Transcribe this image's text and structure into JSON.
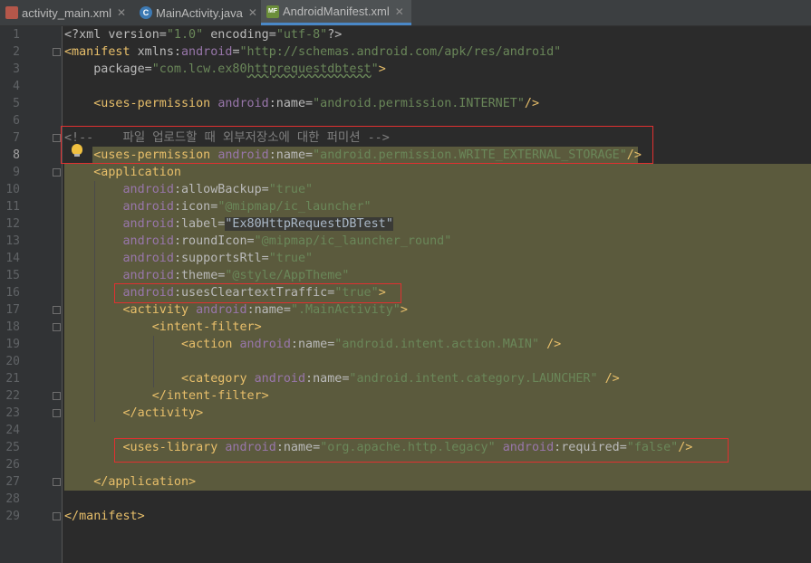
{
  "tabs": [
    {
      "label": "activity_main.xml",
      "icon": "xml-file-icon"
    },
    {
      "label": "MainActivity.java",
      "icon": "java-class-icon"
    },
    {
      "label": "AndroidManifest.xml",
      "icon": "manifest-file-icon"
    }
  ],
  "colors": {
    "tag": "#e8bf6a",
    "attr_ns": "#9876aa",
    "value": "#6a8759",
    "comment": "#808080",
    "selection": "#5b5a3d",
    "highlight_box": "#e03030"
  },
  "line_numbers": [
    "1",
    "2",
    "3",
    "4",
    "5",
    "6",
    "7",
    "8",
    "9",
    "10",
    "11",
    "12",
    "13",
    "14",
    "15",
    "16",
    "17",
    "18",
    "19",
    "20",
    "21",
    "22",
    "23",
    "24",
    "25",
    "26",
    "27",
    "28",
    "29"
  ],
  "code": {
    "l1": {
      "p1": "<?xml version=",
      "p2": "\"1.0\"",
      "p3": " encoding=",
      "p4": "\"utf-8\"",
      "p5": "?>"
    },
    "l2": {
      "p1": "<manifest ",
      "p2": "xmlns:",
      "p3": "android",
      "p4": "=",
      "p5": "\"http://schemas.android.com/apk/res/android\""
    },
    "l3": {
      "p1": "    package=",
      "p2": "\"com.lcw.ex80",
      "p3": "httprequestdbtest",
      "p4": "\"",
      "p5": ">"
    },
    "l5": {
      "p1": "    <uses-permission ",
      "p2": "android",
      "p3": ":name=",
      "p4": "\"android.permission.INTERNET\"",
      "p5": "/>"
    },
    "l7": {
      "p1": "<!--    파일 업로드할 때 외부저장소에 대한 퍼미션 -->"
    },
    "l8": {
      "p1": "    <uses-permission ",
      "p2": "android",
      "p3": ":name=",
      "p4": "\"android.permission.WRITE_EXTERNAL_STORAGE\"",
      "p5": "/>"
    },
    "l9": {
      "p1": "    <application"
    },
    "l10": {
      "p1": "        android",
      "p2": ":allowBackup=",
      "p3": "\"true\""
    },
    "l11": {
      "p1": "        android",
      "p2": ":icon=",
      "p3": "\"@mipmap/ic_launcher\""
    },
    "l12": {
      "p1": "        android",
      "p2": ":label=",
      "p3": "\"Ex80HttpRequestDBTest\""
    },
    "l13": {
      "p1": "        android",
      "p2": ":roundIcon=",
      "p3": "\"@mipmap/ic_launcher_round\""
    },
    "l14": {
      "p1": "        android",
      "p2": ":supportsRtl=",
      "p3": "\"true\""
    },
    "l15": {
      "p1": "        android",
      "p2": ":theme=",
      "p3": "\"@style/AppTheme\""
    },
    "l16": {
      "p1": "        android",
      "p2": ":usesCleartextTraffic=",
      "p3": "\"true\"",
      "p4": ">"
    },
    "l17": {
      "p1": "        <activity ",
      "p2": "android",
      "p3": ":name=",
      "p4": "\".MainActivity\"",
      "p5": ">"
    },
    "l18": {
      "p1": "            <intent-filter>"
    },
    "l19": {
      "p1": "                <action ",
      "p2": "android",
      "p3": ":name=",
      "p4": "\"android.intent.action.MAIN\"",
      "p5": " />"
    },
    "l21": {
      "p1": "                <category ",
      "p2": "android",
      "p3": ":name=",
      "p4": "\"android.intent.category.LAUNCHER\"",
      "p5": " />"
    },
    "l22": {
      "p1": "            </intent-filter>"
    },
    "l23": {
      "p1": "        </activity>"
    },
    "l25": {
      "p1": "        <uses-library ",
      "p2": "android",
      "p3": ":name=",
      "p4": "\"org.apache.http.legacy\"",
      "p5": " android",
      "p6": ":required=",
      "p7": "\"false\"",
      "p8": "/>"
    },
    "l27": {
      "p1": "    </application>"
    },
    "l29": {
      "p1": "</manifest>"
    }
  }
}
